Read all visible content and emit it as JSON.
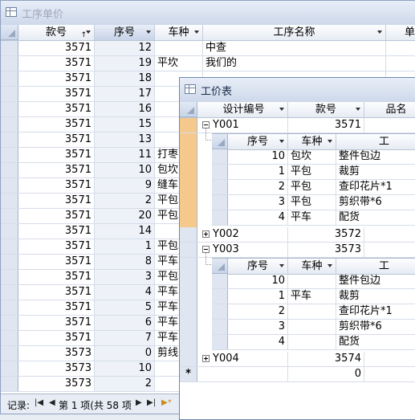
{
  "window1": {
    "title": "工序单价",
    "columns": [
      "款号",
      "序号",
      "车种",
      "工序名称",
      "单"
    ],
    "rows": [
      {
        "style_no": "3571",
        "seq": "12",
        "car_type": "",
        "process_name": "中查"
      },
      {
        "style_no": "3571",
        "seq": "19",
        "car_type": "平坎",
        "process_name": "我们的"
      },
      {
        "style_no": "3571",
        "seq": "18",
        "car_type": "",
        "process_name": ""
      },
      {
        "style_no": "3571",
        "seq": "17",
        "car_type": "",
        "process_name": ""
      },
      {
        "style_no": "3571",
        "seq": "16",
        "car_type": "",
        "process_name": ""
      },
      {
        "style_no": "3571",
        "seq": "15",
        "car_type": "",
        "process_name": ""
      },
      {
        "style_no": "3571",
        "seq": "13",
        "car_type": "",
        "process_name": ""
      },
      {
        "style_no": "3571",
        "seq": "11",
        "car_type": "打枣",
        "process_name": ""
      },
      {
        "style_no": "3571",
        "seq": "10",
        "car_type": "包坎",
        "process_name": ""
      },
      {
        "style_no": "3571",
        "seq": "9",
        "car_type": "缝车",
        "process_name": ""
      },
      {
        "style_no": "3571",
        "seq": "2",
        "car_type": "平包",
        "process_name": ""
      },
      {
        "style_no": "3571",
        "seq": "20",
        "car_type": "平包",
        "process_name": ""
      },
      {
        "style_no": "3571",
        "seq": "14",
        "car_type": "",
        "process_name": ""
      },
      {
        "style_no": "3571",
        "seq": "1",
        "car_type": "平包",
        "process_name": ""
      },
      {
        "style_no": "3571",
        "seq": "8",
        "car_type": "平车",
        "process_name": ""
      },
      {
        "style_no": "3571",
        "seq": "3",
        "car_type": "平包",
        "process_name": ""
      },
      {
        "style_no": "3571",
        "seq": "4",
        "car_type": "平车",
        "process_name": ""
      },
      {
        "style_no": "3571",
        "seq": "5",
        "car_type": "平车",
        "process_name": ""
      },
      {
        "style_no": "3571",
        "seq": "6",
        "car_type": "平车",
        "process_name": ""
      },
      {
        "style_no": "3571",
        "seq": "7",
        "car_type": "平车",
        "process_name": ""
      },
      {
        "style_no": "3573",
        "seq": "0",
        "car_type": "剪线",
        "process_name": ""
      },
      {
        "style_no": "3573",
        "seq": "10",
        "car_type": "",
        "process_name": ""
      },
      {
        "style_no": "3573",
        "seq": "2",
        "car_type": "",
        "process_name": ""
      }
    ],
    "nav": {
      "label": "记录:",
      "position": "第 1 项(共 58 项"
    }
  },
  "window2": {
    "title": "工价表",
    "columns": [
      "设计编号",
      "款号",
      "品名"
    ],
    "sub_columns": [
      "序号",
      "车种",
      "工"
    ],
    "groups": [
      {
        "design_no": "Y001",
        "style_no": "3571",
        "expanded": true,
        "rows": [
          {
            "seq": "10",
            "car_type": "包坎",
            "process": "整件包边"
          },
          {
            "seq": "1",
            "car_type": "平包",
            "process": "裁剪"
          },
          {
            "seq": "2",
            "car_type": "平包",
            "process": "查印花片*1"
          },
          {
            "seq": "3",
            "car_type": "平包",
            "process": "剪织带*6"
          },
          {
            "seq": "4",
            "car_type": "平车",
            "process": "配货"
          }
        ]
      },
      {
        "design_no": "Y002",
        "style_no": "3572",
        "expanded": false,
        "rows": []
      },
      {
        "design_no": "Y003",
        "style_no": "3573",
        "expanded": true,
        "rows": [
          {
            "seq": "10",
            "car_type": "",
            "process": "整件包边"
          },
          {
            "seq": "1",
            "car_type": "平车",
            "process": "裁剪"
          },
          {
            "seq": "2",
            "car_type": "",
            "process": "查印花片*1"
          },
          {
            "seq": "3",
            "car_type": "",
            "process": "剪织带*6"
          },
          {
            "seq": "4",
            "car_type": "",
            "process": "配货"
          }
        ]
      },
      {
        "design_no": "Y004",
        "style_no": "3574",
        "expanded": false,
        "rows": []
      }
    ],
    "new_row": {
      "marker": "*",
      "style_no": "0"
    }
  },
  "colors": {
    "selected_row_bar": "#f5c98c",
    "header_sorted": "#c7d3e8"
  }
}
